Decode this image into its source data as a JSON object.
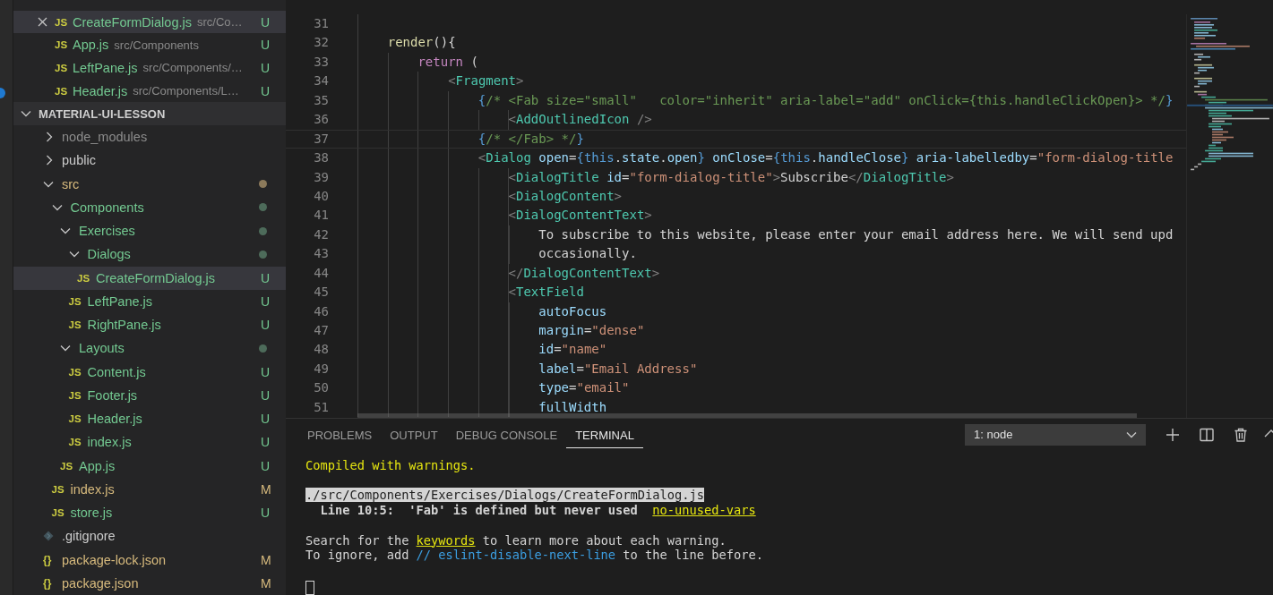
{
  "open_editors": {
    "items": [
      {
        "name": "CreateFormDialog.js",
        "icon": "JS",
        "path": "src/Co…",
        "status": "U",
        "color": "#73c991",
        "selected": true
      },
      {
        "name": "App.js",
        "icon": "JS",
        "path": "src/Components",
        "status": "U",
        "color": "#73c991",
        "selected": false
      },
      {
        "name": "LeftPane.js",
        "icon": "JS",
        "path": "src/Components/…",
        "status": "U",
        "color": "#73c991",
        "selected": false
      },
      {
        "name": "Header.js",
        "icon": "JS",
        "path": "src/Components/L…",
        "status": "U",
        "color": "#73c991",
        "selected": false
      }
    ]
  },
  "explorer": {
    "title": "MATERIAL-UI-LESSON",
    "expanded": true,
    "items": [
      {
        "label": "node_modules",
        "kind": "folder",
        "expanded": false,
        "color": "#8c8c8c",
        "selected": false
      },
      {
        "label": "public",
        "kind": "folder",
        "expanded": false,
        "color": "#cccccc",
        "selected": false
      },
      {
        "label": "src",
        "kind": "folder",
        "expanded": true,
        "color": "#d7ba7d",
        "dot": {
          "color": "#8c7a5b"
        },
        "selected": false,
        "children": [
          {
            "label": "Components",
            "kind": "folder",
            "expanded": true,
            "color": "#73c991",
            "dot": {
              "color": "#4d6b5a"
            },
            "selected": false,
            "children": [
              {
                "label": "Exercises",
                "kind": "folder",
                "expanded": true,
                "color": "#73c991",
                "dot": {
                  "color": "#4d6b5a"
                },
                "selected": false,
                "children": [
                  {
                    "label": "Dialogs",
                    "kind": "folder",
                    "expanded": true,
                    "color": "#73c991",
                    "dot": {
                      "color": "#4d6b5a"
                    },
                    "selected": false,
                    "children": [
                      {
                        "label": "CreateFormDialog.js",
                        "kind": "file",
                        "icon": "JS",
                        "status": "U",
                        "color": "#73c991",
                        "selected": true
                      }
                    ]
                  },
                  {
                    "label": "LeftPane.js",
                    "kind": "file",
                    "icon": "JS",
                    "status": "U",
                    "color": "#73c991",
                    "selected": false
                  },
                  {
                    "label": "RightPane.js",
                    "kind": "file",
                    "icon": "JS",
                    "status": "U",
                    "color": "#73c991",
                    "selected": false
                  }
                ]
              },
              {
                "label": "Layouts",
                "kind": "folder",
                "expanded": true,
                "color": "#73c991",
                "dot": {
                  "color": "#4d6b5a"
                },
                "selected": false,
                "children": [
                  {
                    "label": "Content.js",
                    "kind": "file",
                    "icon": "JS",
                    "status": "U",
                    "color": "#73c991",
                    "selected": false
                  },
                  {
                    "label": "Footer.js",
                    "kind": "file",
                    "icon": "JS",
                    "status": "U",
                    "color": "#73c991",
                    "selected": false
                  },
                  {
                    "label": "Header.js",
                    "kind": "file",
                    "icon": "JS",
                    "status": "U",
                    "color": "#73c991",
                    "selected": false
                  },
                  {
                    "label": "index.js",
                    "kind": "file",
                    "icon": "JS",
                    "status": "U",
                    "color": "#73c991",
                    "selected": false
                  }
                ]
              },
              {
                "label": "App.js",
                "kind": "file",
                "icon": "JS",
                "status": "U",
                "color": "#73c991",
                "selected": false
              }
            ]
          },
          {
            "label": "index.js",
            "kind": "file",
            "icon": "JS",
            "status": "M",
            "color": "#d7ba7d",
            "selected": false
          },
          {
            "label": "store.js",
            "kind": "file",
            "icon": "JS",
            "status": "U",
            "color": "#73c991",
            "selected": false
          }
        ]
      },
      {
        "label": ".gitignore",
        "kind": "gitfile",
        "color": "#cccccc",
        "selected": false
      },
      {
        "label": "package-lock.json",
        "kind": "file",
        "icon": "{}",
        "status": "M",
        "color": "#d7ba7d",
        "selected": false
      },
      {
        "label": "package.json",
        "kind": "file",
        "icon": "{}",
        "status": "M",
        "color": "#d7ba7d",
        "selected": false
      }
    ]
  },
  "code": {
    "lines": [
      {
        "number": "31",
        "current": false
      },
      {
        "number": "32",
        "current": false,
        "tokens": [
          {
            "kind": "func",
            "text": "    render"
          },
          {
            "kind": "plain",
            "text": "(){"
          }
        ]
      },
      {
        "number": "33",
        "current": false,
        "tokens": [
          {
            "kind": "keyword",
            "text": "        return"
          },
          {
            "kind": "plain",
            "text": " ("
          }
        ]
      },
      {
        "number": "34",
        "current": false,
        "tokens": [
          {
            "kind": "punct",
            "text": "            <"
          },
          {
            "kind": "tag",
            "text": "Fragment"
          },
          {
            "kind": "punct",
            "text": ">"
          }
        ]
      },
      {
        "number": "35",
        "current": false,
        "tokens": [
          {
            "kind": "brace",
            "text": "                {"
          },
          {
            "kind": "comment",
            "text": "/* <Fab size=\"small\"   color=\"inherit\" aria-label=\"add\" onClick={this.handleClickOpen}> */"
          },
          {
            "kind": "brace",
            "text": "}"
          }
        ]
      },
      {
        "number": "36",
        "current": false,
        "tokens": [
          {
            "kind": "punct",
            "text": "                    <"
          },
          {
            "kind": "tag",
            "text": "AddOutlinedIcon"
          },
          {
            "kind": "punct",
            "text": " />"
          }
        ]
      },
      {
        "number": "37",
        "current": true,
        "tokens": [
          {
            "kind": "brace",
            "text": "                {"
          },
          {
            "kind": "comment",
            "text": "/* </Fab> */"
          },
          {
            "kind": "brace",
            "text": "}"
          }
        ]
      },
      {
        "number": "38",
        "current": false,
        "tokens": [
          {
            "kind": "punct",
            "text": "                <"
          },
          {
            "kind": "tag",
            "text": "Dialog"
          },
          {
            "kind": "attr",
            "text": " open"
          },
          {
            "kind": "plain",
            "text": "="
          },
          {
            "kind": "brace",
            "text": "{"
          },
          {
            "kind": "this",
            "text": "this"
          },
          {
            "kind": "plain",
            "text": "."
          },
          {
            "kind": "var",
            "text": "state"
          },
          {
            "kind": "plain",
            "text": "."
          },
          {
            "kind": "var",
            "text": "open"
          },
          {
            "kind": "brace",
            "text": "}"
          },
          {
            "kind": "attr",
            "text": " onClose"
          },
          {
            "kind": "plain",
            "text": "="
          },
          {
            "kind": "brace",
            "text": "{"
          },
          {
            "kind": "this",
            "text": "this"
          },
          {
            "kind": "plain",
            "text": "."
          },
          {
            "kind": "var",
            "text": "handleClose"
          },
          {
            "kind": "brace",
            "text": "}"
          },
          {
            "kind": "attr",
            "text": " aria-labelledby"
          },
          {
            "kind": "plain",
            "text": "="
          },
          {
            "kind": "string",
            "text": "\"form-dialog-title"
          }
        ]
      },
      {
        "number": "39",
        "current": false,
        "tokens": [
          {
            "kind": "punct",
            "text": "                    <"
          },
          {
            "kind": "tag",
            "text": "DialogTitle"
          },
          {
            "kind": "attr",
            "text": " id"
          },
          {
            "kind": "plain",
            "text": "="
          },
          {
            "kind": "string",
            "text": "\"form-dialog-title\""
          },
          {
            "kind": "punct",
            "text": ">"
          },
          {
            "kind": "plain",
            "text": "Subscribe"
          },
          {
            "kind": "punct",
            "text": "</"
          },
          {
            "kind": "tag",
            "text": "DialogTitle"
          },
          {
            "kind": "punct",
            "text": ">"
          }
        ]
      },
      {
        "number": "40",
        "current": false,
        "tokens": [
          {
            "kind": "punct",
            "text": "                    <"
          },
          {
            "kind": "tag",
            "text": "DialogContent"
          },
          {
            "kind": "punct",
            "text": ">"
          }
        ]
      },
      {
        "number": "41",
        "current": false,
        "tokens": [
          {
            "kind": "punct",
            "text": "                    <"
          },
          {
            "kind": "tag",
            "text": "DialogContentText"
          },
          {
            "kind": "punct",
            "text": ">"
          }
        ]
      },
      {
        "number": "42",
        "current": false,
        "tokens": [
          {
            "kind": "plain",
            "text": "                        To subscribe to this website, please enter your email address here. We will send upd"
          }
        ]
      },
      {
        "number": "43",
        "current": false,
        "tokens": [
          {
            "kind": "plain",
            "text": "                        occasionally."
          }
        ]
      },
      {
        "number": "44",
        "current": false,
        "tokens": [
          {
            "kind": "punct",
            "text": "                    </"
          },
          {
            "kind": "tag",
            "text": "DialogContentText"
          },
          {
            "kind": "punct",
            "text": ">"
          }
        ]
      },
      {
        "number": "45",
        "current": false,
        "tokens": [
          {
            "kind": "punct",
            "text": "                    <"
          },
          {
            "kind": "tag",
            "text": "TextField"
          }
        ]
      },
      {
        "number": "46",
        "current": false,
        "tokens": [
          {
            "kind": "attr",
            "text": "                        autoFocus"
          }
        ]
      },
      {
        "number": "47",
        "current": false,
        "tokens": [
          {
            "kind": "attr",
            "text": "                        margin"
          },
          {
            "kind": "plain",
            "text": "="
          },
          {
            "kind": "string",
            "text": "\"dense\""
          }
        ]
      },
      {
        "number": "48",
        "current": false,
        "tokens": [
          {
            "kind": "attr",
            "text": "                        id"
          },
          {
            "kind": "plain",
            "text": "="
          },
          {
            "kind": "string",
            "text": "\"name\""
          }
        ]
      },
      {
        "number": "49",
        "current": false,
        "tokens": [
          {
            "kind": "attr",
            "text": "                        label"
          },
          {
            "kind": "plain",
            "text": "="
          },
          {
            "kind": "string",
            "text": "\"Email Address\""
          }
        ]
      },
      {
        "number": "50",
        "current": false,
        "tokens": [
          {
            "kind": "attr",
            "text": "                        type"
          },
          {
            "kind": "plain",
            "text": "="
          },
          {
            "kind": "string",
            "text": "\"email\""
          }
        ]
      },
      {
        "number": "51",
        "current": false,
        "tokens": [
          {
            "kind": "attr",
            "text": "                        fullWidth"
          }
        ]
      }
    ]
  },
  "panel": {
    "tabs": [
      {
        "label": "PROBLEMS",
        "selected": false
      },
      {
        "label": "OUTPUT",
        "selected": false
      },
      {
        "label": "DEBUG CONSOLE",
        "selected": false
      },
      {
        "label": "TERMINAL",
        "selected": true
      }
    ],
    "terminal_select": "1: node",
    "terminal": {
      "cursor": true,
      "lines": [
        {
          "kind": "text",
          "segments": [
            {
              "kind": "warn",
              "text": "Compiled with warnings."
            }
          ]
        },
        {
          "kind": "blank"
        },
        {
          "kind": "text",
          "segments": [
            {
              "kind": "highlight",
              "text": "./src/Components/Exercises/Dialogs/CreateFormDialog.js"
            }
          ]
        },
        {
          "kind": "text",
          "segments": [
            {
              "kind": "bold",
              "text": "  Line 10:5:  'Fab' is defined but never used  "
            },
            {
              "kind": "link",
              "text": "no-unused-vars"
            }
          ]
        },
        {
          "kind": "blank"
        },
        {
          "kind": "text",
          "segments": [
            {
              "kind": "plain",
              "text": "Search for the "
            },
            {
              "kind": "link",
              "text": "keywords"
            },
            {
              "kind": "plain",
              "text": " to learn more about each warning."
            }
          ]
        },
        {
          "kind": "text",
          "segments": [
            {
              "kind": "plain",
              "text": "To ignore, add "
            },
            {
              "kind": "comment",
              "text": "// eslint-disable-next-line"
            },
            {
              "kind": "plain",
              "text": " to the line before."
            }
          ]
        },
        {
          "kind": "blank"
        }
      ]
    }
  }
}
